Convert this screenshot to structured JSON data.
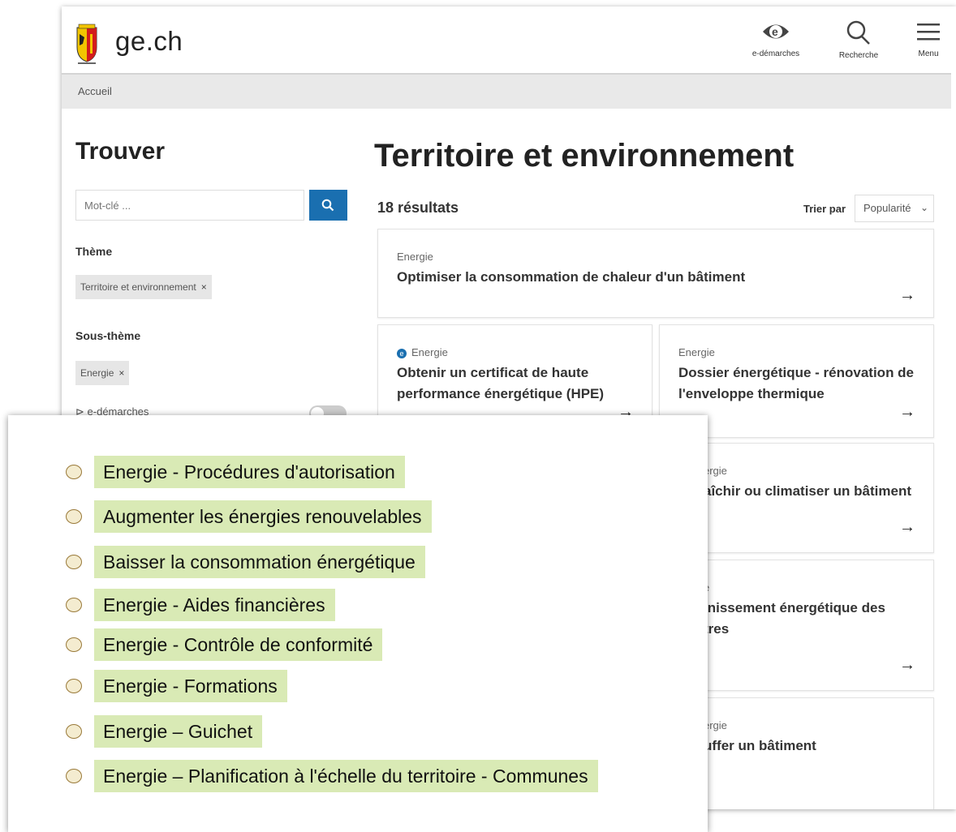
{
  "header": {
    "brand": "ge.ch",
    "edemarches_label": "e-démarches",
    "recherche_label": "Recherche",
    "menu_label": "Menu"
  },
  "breadcrumb": {
    "accueil": "Accueil"
  },
  "sidebar": {
    "title": "Trouver",
    "search_placeholder": "Mot-clé ...",
    "theme_label": "Thème",
    "theme_chip": "Territoire et environnement",
    "soustheme_label": "Sous-thème",
    "soustheme_chip": "Energie",
    "chip_remove": "×",
    "edemarches_filter": "e-démarches"
  },
  "main": {
    "title": "Territoire et environnement",
    "results_count": "18 résultats",
    "sort_label": "Trier par",
    "sort_value": "Popularité",
    "arrow": "→",
    "cards": [
      {
        "category": "Energie",
        "title": "Optimiser la consommation de chaleur d'un bâtiment"
      },
      {
        "category": "Energie",
        "title": "Obtenir un certificat de haute performance énergétique (HPE)"
      },
      {
        "category": "Energie",
        "title": "Dossier énergétique - rénovation de l'enveloppe thermique"
      },
      {
        "category": "ergie",
        "title": "aîchir ou climatiser un bâtiment"
      },
      {
        "category": "e",
        "title": "inissement énergétique des",
        "title2": "tres"
      },
      {
        "category": "ergie",
        "title": "uffer un bâtiment"
      }
    ]
  },
  "overlay": {
    "options": [
      "Energie - Procédures d'autorisation",
      "Augmenter les énergies renouvelables",
      "Baisser la consommation énergétique",
      "Energie - Aides financières",
      "Energie - Contrôle de conformité",
      "Energie - Formations",
      "Energie – Guichet",
      "Energie – Planification à l'échelle du territoire - Communes"
    ]
  },
  "colors": {
    "accent_blue": "#1a6fb0",
    "highlight_green": "#d9eab5",
    "breadcrumb_bg": "#e9e9e9"
  }
}
